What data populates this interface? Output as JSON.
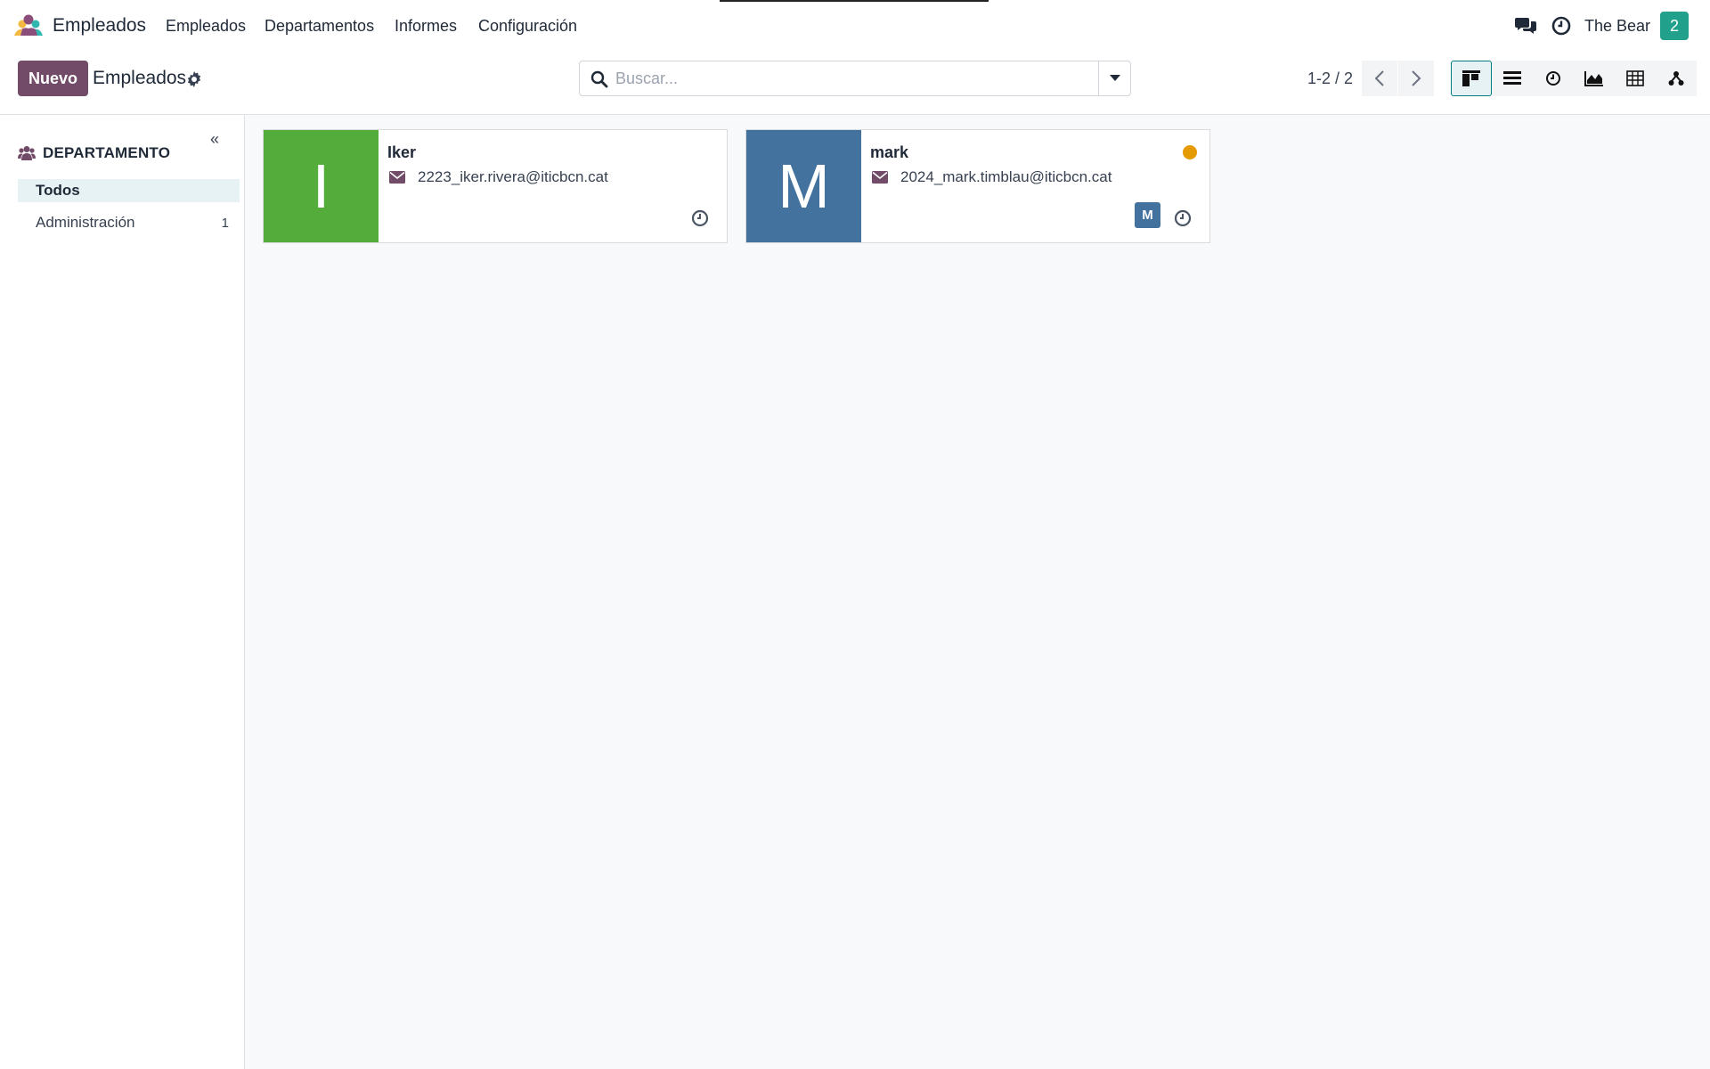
{
  "app": {
    "name": "Empleados",
    "logo_icon": "employees-app-icon"
  },
  "menu": [
    "Empleados",
    "Departamentos",
    "Informes",
    "Configuración"
  ],
  "user": {
    "name": "The Bear",
    "badge": "2",
    "badge_color": "#21a08c"
  },
  "control": {
    "new_label": "Nuevo",
    "breadcrumb": "Empleados",
    "search_placeholder": "Buscar...",
    "pager": "1-2 / 2",
    "views": [
      "kanban",
      "list",
      "activity",
      "graph",
      "pivot",
      "hierarchy"
    ],
    "active_view": "kanban"
  },
  "sidebar": {
    "title": "DEPARTAMENTO",
    "items": [
      {
        "label": "Todos",
        "count": ""
      },
      {
        "label": "Administración",
        "count": "1"
      }
    ]
  },
  "employees": [
    {
      "initial": "I",
      "name": "Iker",
      "email": "2223_iker.rivera@iticbcn.cat",
      "color": "#54ac3b"
    },
    {
      "initial": "M",
      "name": "mark",
      "email": "2024_mark.timblau@iticbcn.cat",
      "color": "#44729f",
      "manager_initial": "M",
      "status_color": "#e59a00"
    }
  ],
  "colors": {
    "brand": "#714b67",
    "accent": "#017e84"
  }
}
